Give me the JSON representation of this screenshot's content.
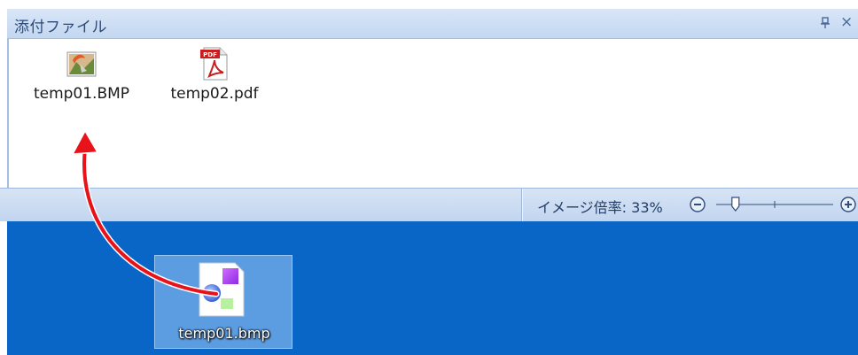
{
  "panel": {
    "title": "添付ファイル",
    "pin_icon": "pin-icon",
    "close_glyph": "×",
    "files": [
      {
        "name": "temp01.BMP",
        "icon": "bitmap-image-icon"
      },
      {
        "name": "temp02.pdf",
        "icon": "pdf-file-icon"
      }
    ]
  },
  "statusbar": {
    "zoom_label": "イメージ倍率: 33%",
    "zoom_level_percent": 33,
    "zoom_out_icon": "zoom-out-icon",
    "zoom_in_icon": "zoom-in-icon"
  },
  "desktop": {
    "file": {
      "name": "temp01.bmp",
      "icon": "bmp-file-icon"
    }
  },
  "colors": {
    "desktop_background": "#0a66c6",
    "drag_arrow": "#e8121a",
    "title_text": "#2a4a78"
  }
}
